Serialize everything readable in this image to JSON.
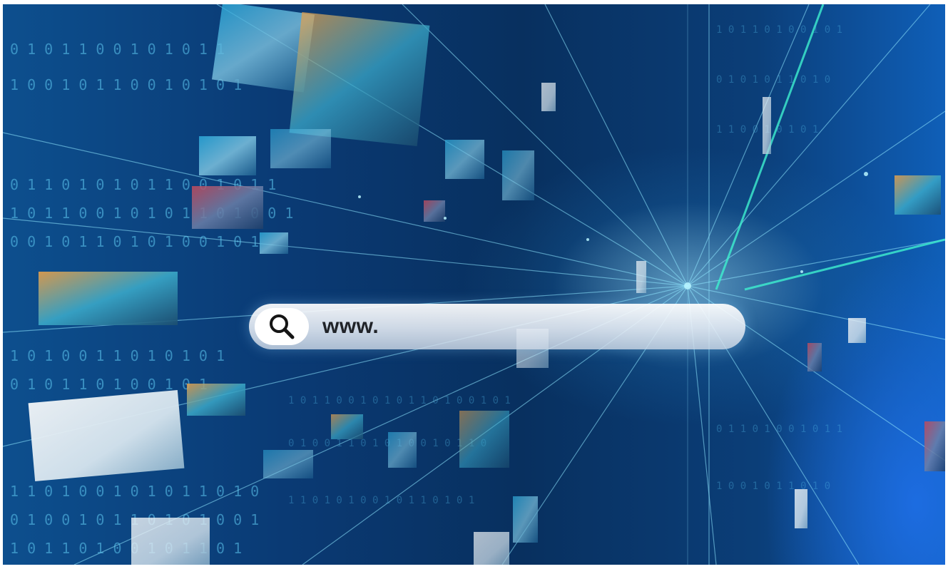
{
  "search": {
    "value": "www."
  },
  "icons": {
    "search": "magnifier-icon"
  },
  "colors": {
    "background_deep": "#08305f",
    "background_mid": "#0d4f8e",
    "glow": "#a0e6ff",
    "accent_blue": "#0f5fb8",
    "search_text": "#202328"
  }
}
